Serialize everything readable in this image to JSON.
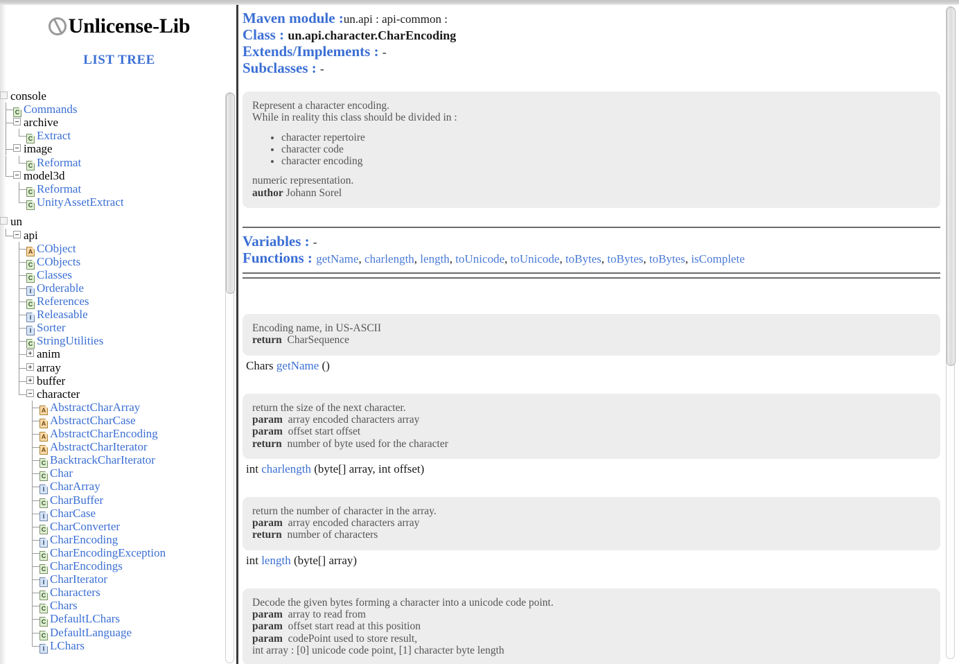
{
  "brand": {
    "title": "Unlicense-Lib",
    "logo_icon": "no-copyright-slash-icon",
    "list_tree_label": "LIST TREE"
  },
  "tree": {
    "roots": [
      {
        "label": "console",
        "kind": "root",
        "state": "empty",
        "children": [
          {
            "label": "Commands",
            "icon": "C",
            "kind": "class"
          },
          {
            "label": "archive",
            "kind": "package",
            "state": "minus",
            "children": [
              {
                "label": "Extract",
                "icon": "C",
                "kind": "class"
              }
            ]
          },
          {
            "label": "image",
            "kind": "package",
            "state": "minus",
            "children": [
              {
                "label": "Reformat",
                "icon": "C",
                "kind": "class"
              }
            ]
          },
          {
            "label": "model3d",
            "kind": "package",
            "state": "minus",
            "children": [
              {
                "label": "Reformat",
                "icon": "C",
                "kind": "class"
              },
              {
                "label": "UnityAssetExtract",
                "icon": "C",
                "kind": "class"
              }
            ]
          }
        ]
      },
      {
        "label": "un",
        "kind": "root",
        "state": "empty",
        "children": [
          {
            "label": "api",
            "kind": "package",
            "state": "minus",
            "children": [
              {
                "label": "CObject",
                "icon": "A",
                "kind": "abstract"
              },
              {
                "label": "CObjects",
                "icon": "C",
                "kind": "class"
              },
              {
                "label": "Classes",
                "icon": "C",
                "kind": "class"
              },
              {
                "label": "Orderable",
                "icon": "I",
                "kind": "interface"
              },
              {
                "label": "References",
                "icon": "C",
                "kind": "class"
              },
              {
                "label": "Releasable",
                "icon": "I",
                "kind": "interface"
              },
              {
                "label": "Sorter",
                "icon": "I",
                "kind": "interface"
              },
              {
                "label": "StringUtilities",
                "icon": "C",
                "kind": "class"
              },
              {
                "label": "anim",
                "kind": "package",
                "state": "plus"
              },
              {
                "label": "array",
                "kind": "package",
                "state": "plus"
              },
              {
                "label": "buffer",
                "kind": "package",
                "state": "plus"
              },
              {
                "label": "character",
                "kind": "package",
                "state": "minus",
                "children": [
                  {
                    "label": "AbstractCharArray",
                    "icon": "A",
                    "kind": "abstract"
                  },
                  {
                    "label": "AbstractCharCase",
                    "icon": "A",
                    "kind": "abstract"
                  },
                  {
                    "label": "AbstractCharEncoding",
                    "icon": "A",
                    "kind": "abstract"
                  },
                  {
                    "label": "AbstractCharIterator",
                    "icon": "A",
                    "kind": "abstract"
                  },
                  {
                    "label": "BacktrackCharIterator",
                    "icon": "C",
                    "kind": "class"
                  },
                  {
                    "label": "Char",
                    "icon": "C",
                    "kind": "class"
                  },
                  {
                    "label": "CharArray",
                    "icon": "I",
                    "kind": "interface"
                  },
                  {
                    "label": "CharBuffer",
                    "icon": "C",
                    "kind": "class"
                  },
                  {
                    "label": "CharCase",
                    "icon": "I",
                    "kind": "interface"
                  },
                  {
                    "label": "CharConverter",
                    "icon": "C",
                    "kind": "class"
                  },
                  {
                    "label": "CharEncoding",
                    "icon": "I",
                    "kind": "interface"
                  },
                  {
                    "label": "CharEncodingException",
                    "icon": "C",
                    "kind": "class"
                  },
                  {
                    "label": "CharEncodings",
                    "icon": "C",
                    "kind": "class"
                  },
                  {
                    "label": "CharIterator",
                    "icon": "I",
                    "kind": "interface"
                  },
                  {
                    "label": "Characters",
                    "icon": "C",
                    "kind": "class"
                  },
                  {
                    "label": "Chars",
                    "icon": "C",
                    "kind": "class"
                  },
                  {
                    "label": "DefaultLChars",
                    "icon": "C",
                    "kind": "class"
                  },
                  {
                    "label": "DefaultLanguage",
                    "icon": "C",
                    "kind": "class"
                  },
                  {
                    "label": "LChars",
                    "icon": "I",
                    "kind": "interface"
                  }
                ]
              }
            ]
          }
        ]
      }
    ]
  },
  "header": {
    "module_key": "Maven module :",
    "module_value": "un.api : api-common :",
    "class_key": "Class :",
    "class_value": "un.api.character.CharEncoding",
    "extends_key": "Extends/Implements :",
    "extends_value": "-",
    "subclasses_key": "Subclasses :",
    "subclasses_value": "-"
  },
  "class_doc": {
    "line1": "Represent a character encoding.",
    "line2": "While in reality this class should be divided in :",
    "bullets": [
      "character repertoire",
      "character code",
      "character encoding"
    ],
    "line3": "numeric representation.",
    "author_key": "author",
    "author_value": "Johann Sorel"
  },
  "summary": {
    "variables_key": "Variables :",
    "variables_value": "-",
    "functions_key": "Functions :",
    "functions": [
      "getName",
      "charlength",
      "length",
      "toUnicode",
      "toUnicode",
      "toBytes",
      "toBytes",
      "toBytes",
      "isComplete"
    ]
  },
  "methods": [
    {
      "doc_lines": [
        {
          "text": "Encoding name, in US-ASCII"
        },
        {
          "tag": "return",
          "text": "CharSequence"
        }
      ],
      "return_type": "Chars",
      "name": "getName",
      "params": "()"
    },
    {
      "doc_lines": [
        {
          "text": "return the size of the next character."
        },
        {
          "tag": "param",
          "text": "array encoded characters array"
        },
        {
          "tag": "param",
          "text": "offset start offset"
        },
        {
          "tag": "return",
          "text": "number of byte used for the character"
        }
      ],
      "return_type": "int",
      "name": "charlength",
      "params": "(byte[] array, int offset)"
    },
    {
      "doc_lines": [
        {
          "text": "return the number of character in the array."
        },
        {
          "tag": "param",
          "text": "array encoded characters array"
        },
        {
          "tag": "return",
          "text": "number of characters"
        }
      ],
      "return_type": "int",
      "name": "length",
      "params": "(byte[] array)"
    },
    {
      "doc_lines": [
        {
          "text": "Decode the given bytes forming a character into a unicode code point."
        },
        {
          "tag": "param",
          "text": "array to read from"
        },
        {
          "tag": "param",
          "text": "offset start read at this position"
        },
        {
          "tag": "param",
          "text": "codePoint used to store result,"
        },
        {
          "text": "int array : [0] unicode code point, [1] character byte length"
        }
      ],
      "return_type": "",
      "name": "",
      "params": ""
    }
  ],
  "colors": {
    "accent_blue": "#3b6fd4",
    "link_blue": "#4a7ad6",
    "doc_bg": "#ededed",
    "doc_text": "#555555",
    "rule": "#6b6b6b"
  },
  "scrollbars": {
    "sidebar_thumb_label": "sidebar-scroll-thumb",
    "main_thumb_label": "main-scroll-thumb"
  }
}
